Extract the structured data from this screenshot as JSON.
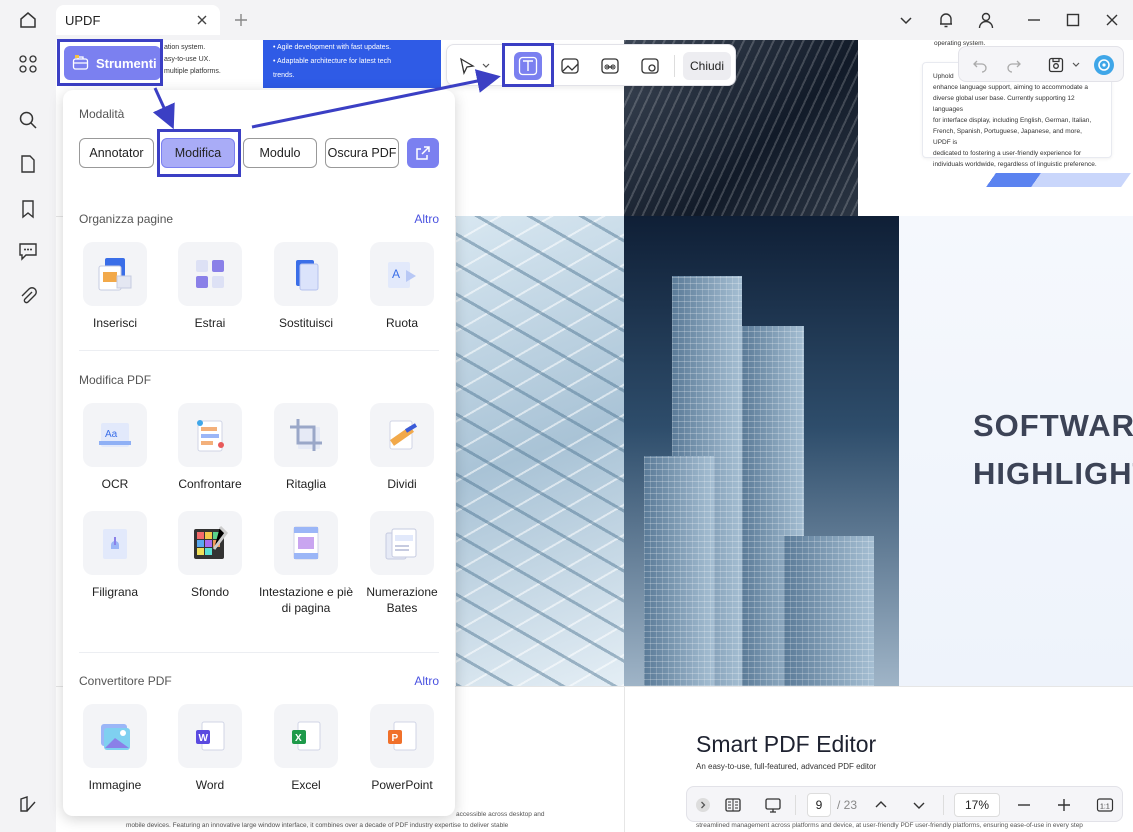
{
  "tab": {
    "title": "UPDF"
  },
  "toolbar": {
    "close_label": "Chiudi"
  },
  "strumenti": {
    "label": "Strumenti"
  },
  "panel": {
    "modes_title": "Modalità",
    "modes": [
      "Annotator",
      "Modifica",
      "Modulo",
      "Oscura PDF"
    ],
    "organize_title": "Organizza pagine",
    "organize_more": "Altro",
    "organize_items": [
      "Inserisci",
      "Estrai",
      "Sostituisci",
      "Ruota"
    ],
    "edit_title": "Modifica PDF",
    "edit_items": [
      "OCR",
      "Confrontare",
      "Ritaglia",
      "Dividi",
      "Filigrana",
      "Sfondo",
      "Intestazione e piè di pagina",
      "Numerazione Bates"
    ],
    "convert_title": "Convertitore PDF",
    "convert_more": "Altro",
    "convert_items": [
      "Immagine",
      "Word",
      "Excel",
      "PowerPoint"
    ]
  },
  "document": {
    "top_left_lines": [
      "ation system.",
      "asy-to-use UX.",
      "multiple platforms."
    ],
    "blue_col_lines": [
      "• Agile development with fast updates.",
      "• Adaptable architecture for latest tech",
      "trends."
    ],
    "card_top": "operating system.",
    "card_lines": [
      "Uphold",
      "enhance language support, aiming to accommodate a",
      "diverse global user base. Currently supporting 12 languages",
      "for interface display, including English, German, Italian,",
      "French, Spanish, Portuguese, Japanese, and more, UPDF is",
      "dedicated to fostering a user-friendly experience for",
      "individuals worldwide, regardless of linguistic preference."
    ],
    "software_line1": "SOFTWAR",
    "software_line2": "HIGHLIGHT",
    "smart_title": "Smart PDF Editor",
    "smart_sub": "An easy-to-use, full-featured, advanced PDF editor",
    "foot_left_1": "accessible across desktop and",
    "foot_left_2": "mobile devices. Featuring an innovative large window interface, it combines over a decade of PDF industry expertise to deliver stable",
    "foot_right": "streamlined management across platforms and device, at user-friendly PDF user-friendly platforms, ensuring ease-of-use in every step"
  },
  "statusbar": {
    "page": "9",
    "total": "/ 23",
    "zoom": "17%"
  },
  "colors": {
    "accent": "#7b80f0",
    "highlight": "#3b3fc4",
    "link": "#4a52e0"
  }
}
